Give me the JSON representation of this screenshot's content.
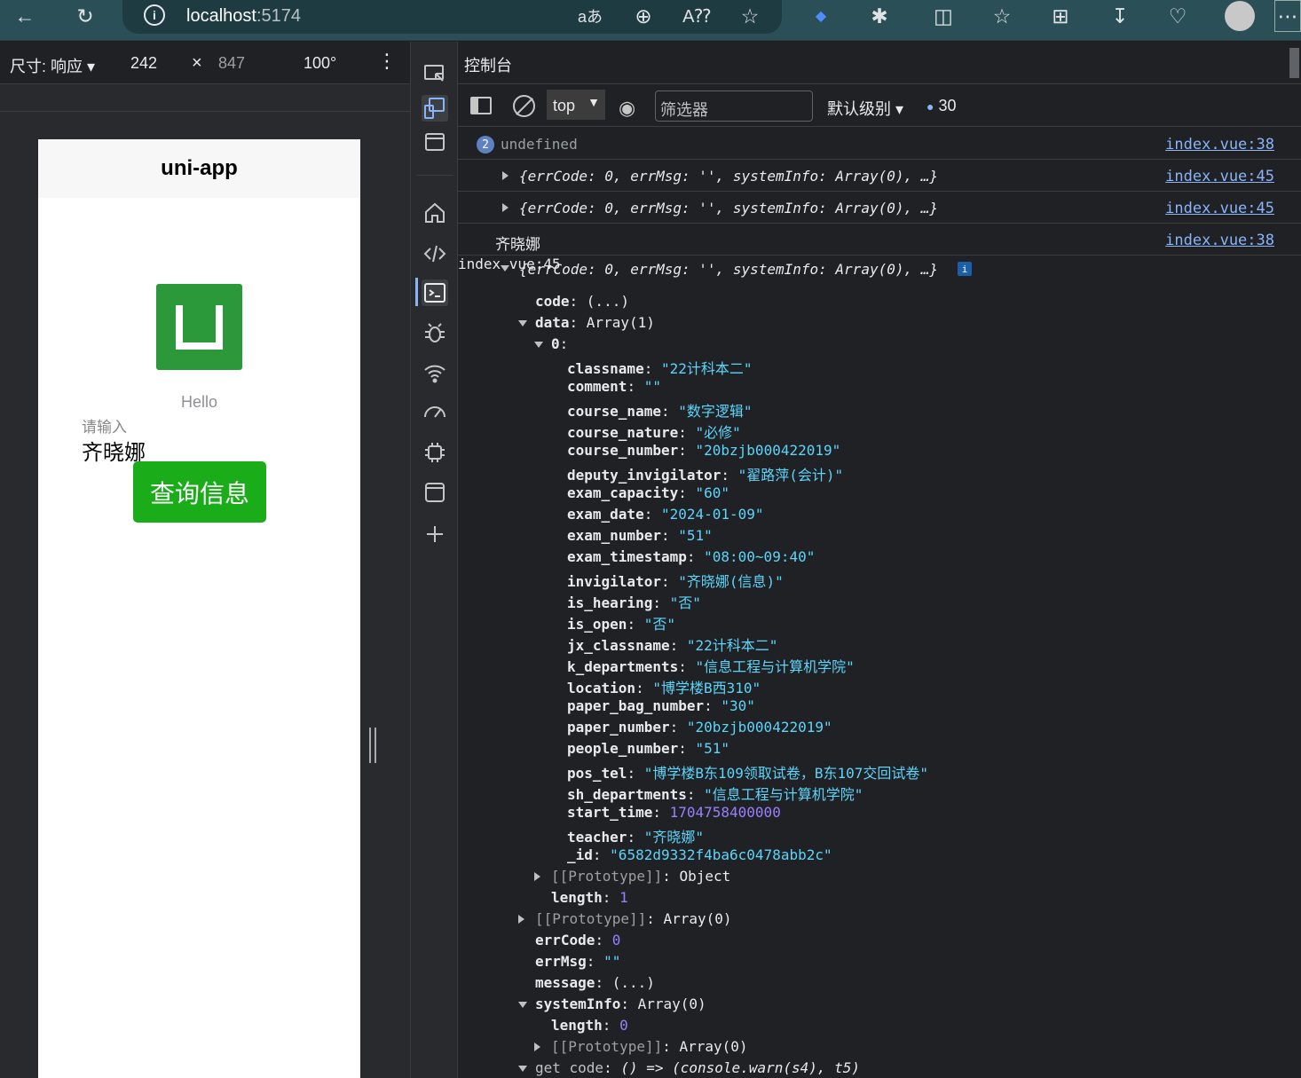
{
  "browser": {
    "url_host": "localhost",
    "url_port": ":5174"
  },
  "device_toolbar": {
    "size_label": "尺寸: 响应 ▾",
    "width": "242",
    "times": "×",
    "height": "847",
    "zoom": "100°"
  },
  "app": {
    "nav_title": "uni-app",
    "hello": "Hello",
    "input_placeholder": "请输入",
    "input_value": "齐晓娜",
    "button_label": "查询信息"
  },
  "console": {
    "title": "控制台",
    "context": "top",
    "filter_placeholder": "筛选器",
    "level": "默认级别 ▾",
    "msg_count": "30",
    "log": [
      {
        "badge": "2",
        "text": "undefined",
        "src": "index.vue:38"
      },
      {
        "text": "{errCode: 0, errMsg: '', systemInfo: Array(0), …}",
        "src": "index.vue:45"
      },
      {
        "text": "{errCode: 0, errMsg: '', systemInfo: Array(0), …}",
        "src": "index.vue:45"
      },
      {
        "text": "齐晓娜",
        "src": "index.vue:38"
      },
      {
        "text": "{errCode: 0, errMsg: '', systemInfo: Array(0), …}",
        "src": "index.vue:45"
      }
    ],
    "tree": [
      {
        "k": "code",
        "v": "(...)"
      },
      {
        "k": "data",
        "v": "Array(1)"
      },
      {
        "k": "0",
        "v": ""
      },
      {
        "k": "classname",
        "v": "\"22计科本二\""
      },
      {
        "k": "comment",
        "v": "\"\""
      },
      {
        "k": "course_name",
        "v": "\"数字逻辑\""
      },
      {
        "k": "course_nature",
        "v": "\"必修\""
      },
      {
        "k": "course_number",
        "v": "\"20bzjb000422019\""
      },
      {
        "k": "deputy_invigilator",
        "v": "\"翟路萍(会计)\""
      },
      {
        "k": "exam_capacity",
        "v": "\"60\""
      },
      {
        "k": "exam_date",
        "v": "\"2024-01-09\""
      },
      {
        "k": "exam_number",
        "v": "\"51\""
      },
      {
        "k": "exam_timestamp",
        "v": "\"08:00~09:40\""
      },
      {
        "k": "invigilator",
        "v": "\"齐晓娜(信息)\""
      },
      {
        "k": "is_hearing",
        "v": "\"否\""
      },
      {
        "k": "is_open",
        "v": "\"否\""
      },
      {
        "k": "jx_classname",
        "v": "\"22计科本二\""
      },
      {
        "k": "k_departments",
        "v": "\"信息工程与计算机学院\""
      },
      {
        "k": "location",
        "v": "\"博学楼B西310\""
      },
      {
        "k": "paper_bag_number",
        "v": "\"30\""
      },
      {
        "k": "paper_number",
        "v": "\"20bzjb000422019\""
      },
      {
        "k": "people_number",
        "v": "\"51\""
      },
      {
        "k": "pos_tel",
        "v": "\"博学楼B东109领取试卷，B东107交回试卷\""
      },
      {
        "k": "sh_departments",
        "v": "\"信息工程与计算机学院\""
      },
      {
        "k": "start_time",
        "v": "1704758400000"
      },
      {
        "k": "teacher",
        "v": "\"齐晓娜\""
      },
      {
        "k": "_id",
        "v": "\"6582d9332f4ba6c0478abb2c\""
      },
      {
        "k": "[[Prototype]]",
        "v": "Object"
      },
      {
        "k": "length",
        "v": "1"
      },
      {
        "k": "[[Prototype]]",
        "v": "Array(0)"
      },
      {
        "k": "errCode",
        "v": "0"
      },
      {
        "k": "errMsg",
        "v": "\"\""
      },
      {
        "k": "message",
        "v": "(...)"
      },
      {
        "k": "systemInfo",
        "v": "Array(0)"
      },
      {
        "k": "length",
        "v": "0"
      },
      {
        "k": "[[Prototype]]",
        "v": "Array(0)"
      },
      {
        "k": "get code",
        "v": "() => (console.warn(s4), t5)"
      }
    ]
  }
}
